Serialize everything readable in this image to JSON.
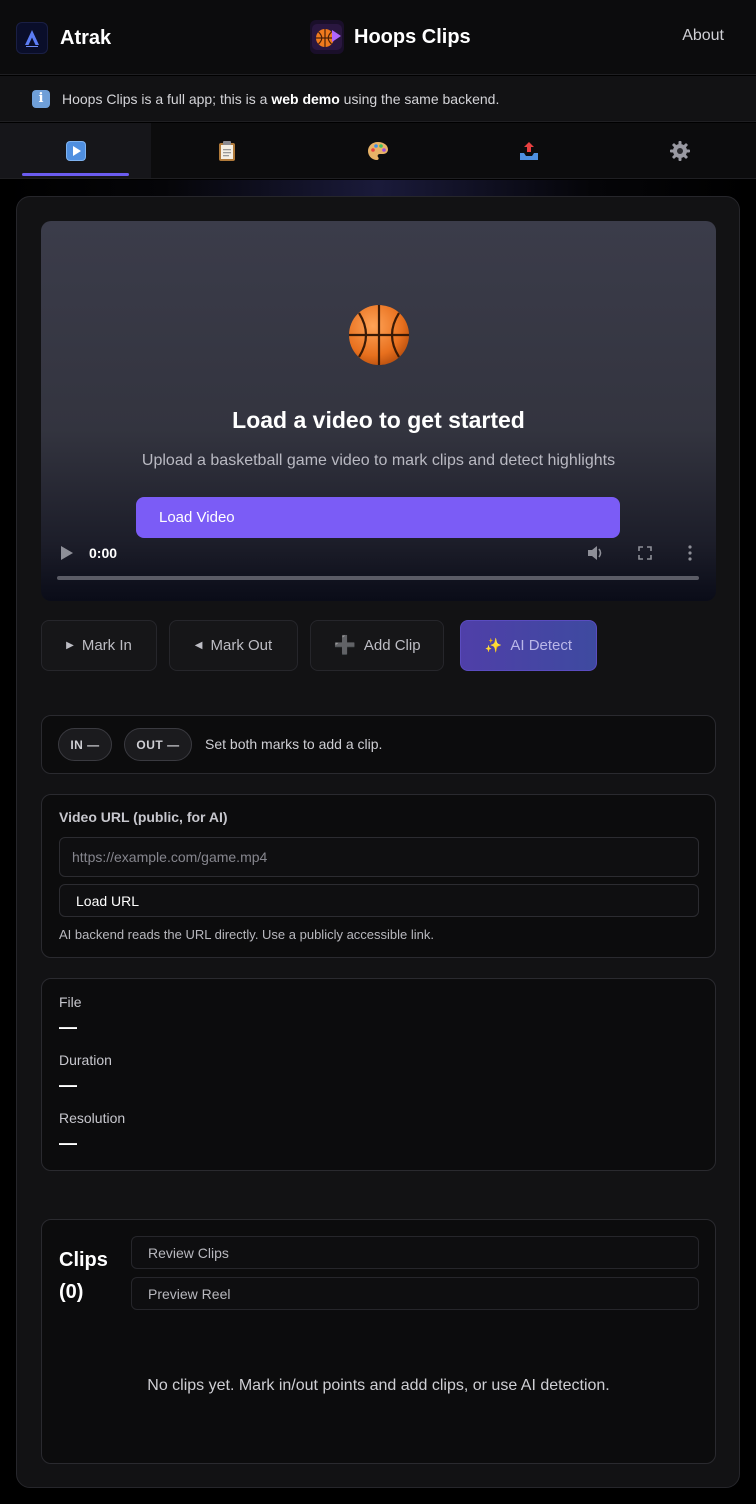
{
  "header": {
    "brand_name": "Atrak",
    "app_name": "Hoops Clips",
    "about_label": "About"
  },
  "infobar": {
    "text_before": "Hoops Clips is a full app; this is a ",
    "text_bold": "web demo",
    "text_after": " using the same backend."
  },
  "tabs": [
    {
      "icon": "play-icon",
      "active": true
    },
    {
      "icon": "clipboard-icon",
      "active": false
    },
    {
      "icon": "palette-icon",
      "active": false
    },
    {
      "icon": "export-tray-icon",
      "active": false
    },
    {
      "icon": "gear-icon",
      "active": false
    }
  ],
  "video": {
    "title": "Load a video to get started",
    "subtitle": "Upload a basketball game video to mark clips and detect highlights",
    "load_button": "Load Video",
    "time": "0:00"
  },
  "actions": {
    "mark_in": "Mark In",
    "mark_out": "Mark Out",
    "add_clip": "Add Clip",
    "ai_detect": "AI Detect"
  },
  "marks": {
    "in_label": "IN —",
    "out_label": "OUT —",
    "hint": "Set both marks to add a clip."
  },
  "url_card": {
    "label": "Video URL (public, for AI)",
    "placeholder": "https://example.com/game.mp4",
    "value": "",
    "button": "Load URL",
    "help": "AI backend reads the URL directly. Use a publicly accessible link."
  },
  "meta": {
    "file_label": "File",
    "file_value": "—",
    "duration_label": "Duration",
    "duration_value": "—",
    "resolution_label": "Resolution",
    "resolution_value": "—"
  },
  "clips": {
    "title": "Clips (0)",
    "review_button": "Review Clips",
    "preview_button": "Preview Reel",
    "empty_text": "No clips yet. Mark in/out points and add clips, or use AI detection."
  },
  "colors": {
    "accent": "#7b5cf6",
    "tab_indicator": "#6b5cf0",
    "background": "#000000",
    "panel": "#121214"
  }
}
